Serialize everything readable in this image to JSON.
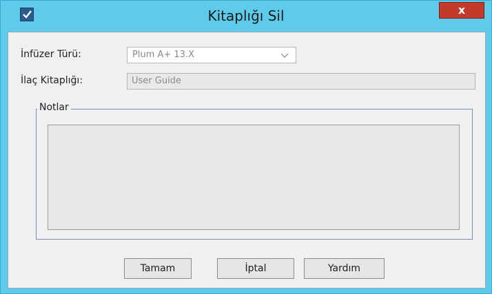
{
  "window": {
    "title": "Kitaplığı Sil",
    "close_label": "x"
  },
  "form": {
    "infuser_type_label": "İnfüzer Türü:",
    "infuser_type_value": "Plum A+ 13.X",
    "drug_library_label": "İlaç Kitaplığı:",
    "drug_library_value": "User Guide",
    "notes_label": "Notlar",
    "notes_value": ""
  },
  "buttons": {
    "ok": "Tamam",
    "cancel": "İptal",
    "help": "Yardım"
  },
  "colors": {
    "titlebar": "#5ecbea",
    "close_button": "#c23a2a",
    "client_background": "#f0f0f0",
    "group_border": "#7f88b8"
  },
  "icons": {
    "app": "checkbox-icon",
    "combo_arrow": "chevron-down-icon"
  }
}
